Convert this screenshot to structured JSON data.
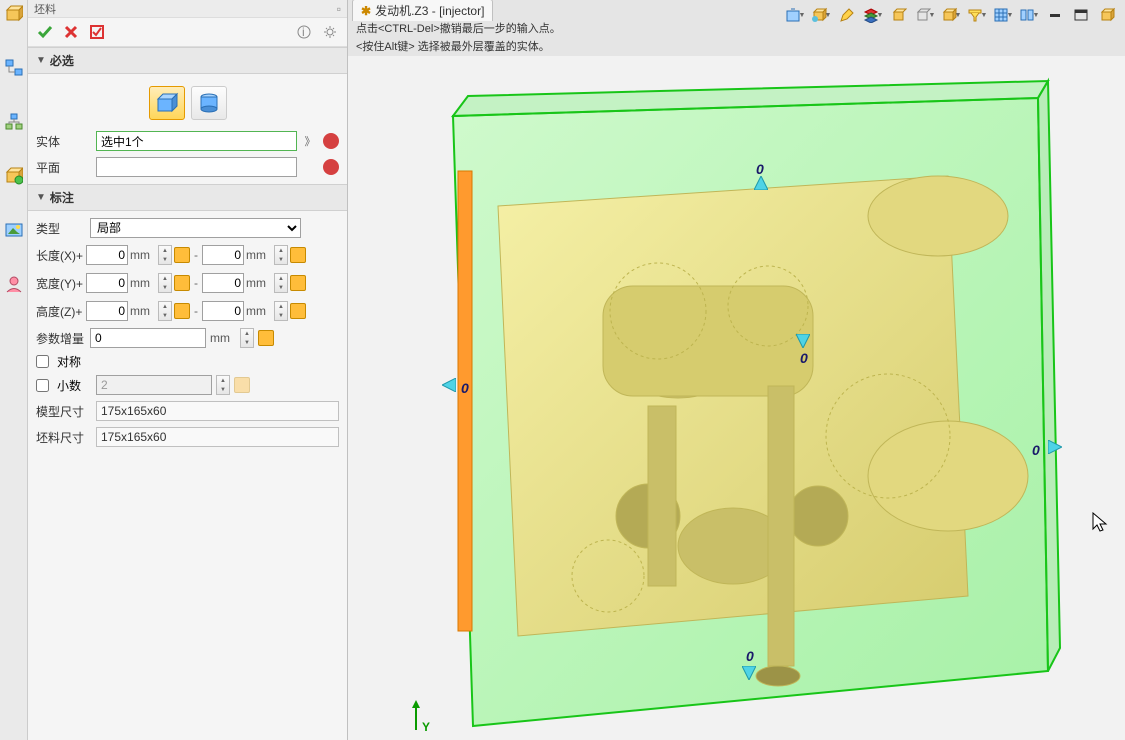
{
  "panel": {
    "title": "坯料",
    "section_required": "必选",
    "section_dims": "标注",
    "body_label": "实体",
    "body_value": "选中1个",
    "plane_label": "平面",
    "plane_value": "",
    "type_label": "类型",
    "type_value": "局部",
    "len_label": "长度(X)+",
    "wid_label": "宽度(Y)+",
    "hgt_label": "高度(Z)+",
    "incr_label": "参数增量",
    "incr_value": "0",
    "sym_label": "对称",
    "dec_label": "小数",
    "dec_value": "2",
    "model_size_label": "模型尺寸",
    "model_size_value": "175x165x60",
    "stock_size_label": "坯料尺寸",
    "stock_size_value": "175x165x60",
    "dim_plus": "0",
    "dim_minus": "0",
    "unit_mm": "mm"
  },
  "tab": {
    "title": "发动机.Z3 - [injector]"
  },
  "tooltip": {
    "line1": "点击<CTRL-Del>撤销最后一步的输入点。",
    "line2": "<按住Alt键> 选择被最外层覆盖的实体。"
  },
  "axis": {
    "y": "Y"
  },
  "markers": {
    "zero": "0"
  }
}
